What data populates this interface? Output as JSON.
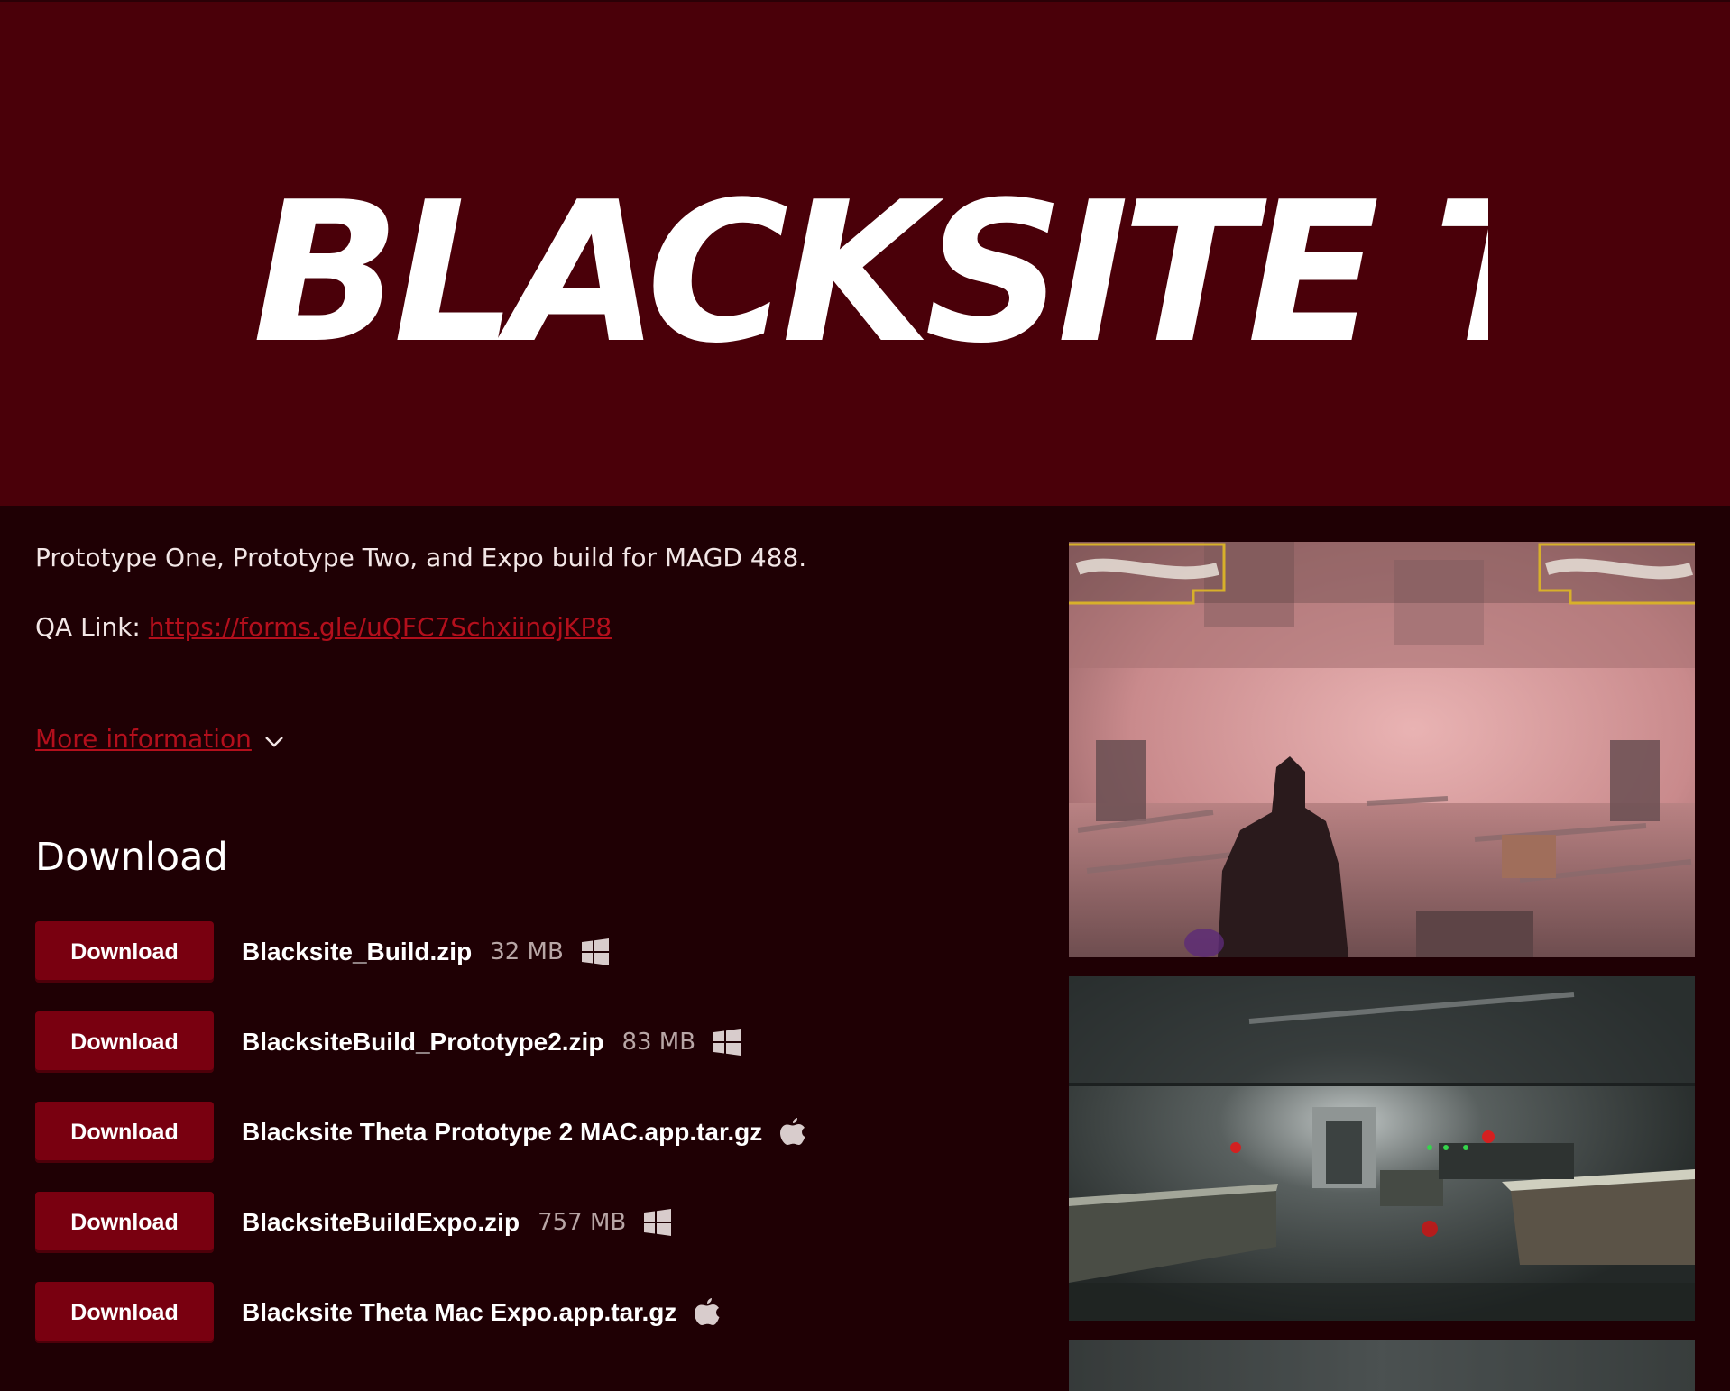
{
  "banner": {
    "logo_text": "BLACKSITE THETA"
  },
  "description": {
    "line1": "Prototype One, Prototype Two, and Expo build for MAGD 488.",
    "qa_label": "QA Link: ",
    "qa_url": "https://forms.gle/uQFC7SchxiinojKP8"
  },
  "more_info": {
    "label": "More information"
  },
  "download_section": {
    "heading": "Download",
    "button_label": "Download",
    "files": [
      {
        "name": "Blacksite_Build.zip",
        "size": "32 MB",
        "platform": "windows-icon"
      },
      {
        "name": "BlacksiteBuild_Prototype2.zip",
        "size": "83 MB",
        "platform": "windows-icon"
      },
      {
        "name": "Blacksite Theta Prototype 2 MAC.app.tar.gz",
        "size": "",
        "platform": "apple-icon"
      },
      {
        "name": "BlacksiteBuildExpo.zip",
        "size": "757 MB",
        "platform": "windows-icon"
      },
      {
        "name": "Blacksite Theta Mac Expo.app.tar.gz",
        "size": "",
        "platform": "apple-icon"
      }
    ]
  },
  "colors": {
    "banner_bg": "#4a0009",
    "page_bg": "#1f0004",
    "button_bg": "#790010",
    "link": "#b30f1c"
  }
}
